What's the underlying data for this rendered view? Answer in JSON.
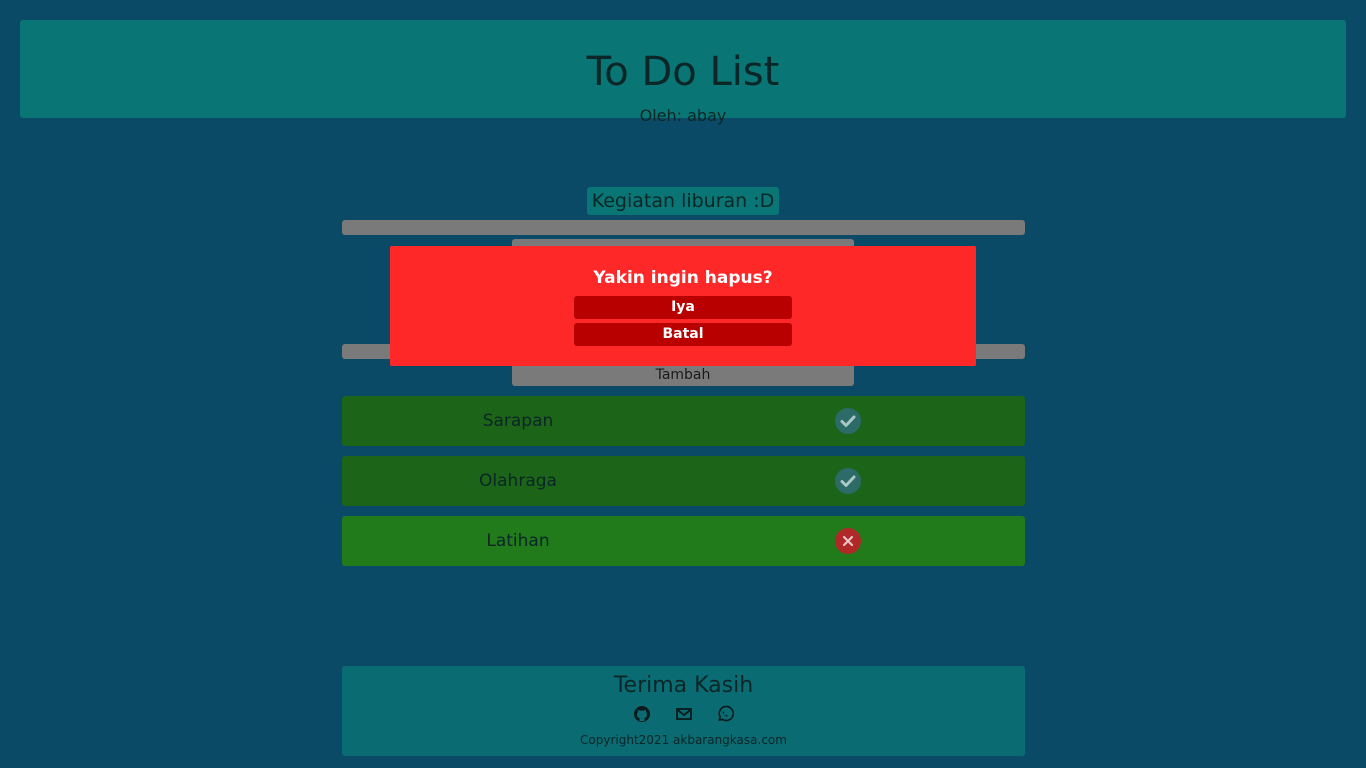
{
  "header": {
    "title": "To Do List",
    "author": "Oleh: abay"
  },
  "list": {
    "title": "Kegiatan liburan :D",
    "add_button": "Tambah"
  },
  "tasks": [
    {
      "label": "Sarapan",
      "status": "done",
      "status_icon": "check-icon"
    },
    {
      "label": "Olahraga",
      "status": "done",
      "status_icon": "check-icon"
    },
    {
      "label": "Latihan",
      "status": "undone",
      "status_icon": "close-icon"
    }
  ],
  "modal": {
    "question": "Yakin ingin hapus?",
    "confirm_label": "Iya",
    "cancel_label": "Batal"
  },
  "footer": {
    "thanks": "Terima Kasih",
    "icons": [
      "github-icon",
      "mail-icon",
      "whatsapp-icon"
    ],
    "copyright": "Copyright2021 akbarangkasa.com"
  },
  "colors": {
    "background": "#0b4a66",
    "header": "#0a7575",
    "task_done": "#1c6417",
    "task_undone": "#217b1a",
    "modal": "#ff2828",
    "modal_button": "#b80000"
  }
}
